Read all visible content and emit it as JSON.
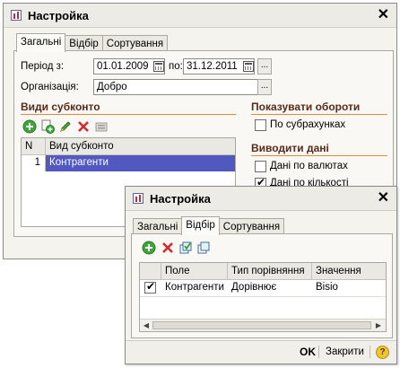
{
  "back_window": {
    "title": "Настройка",
    "close": "✕",
    "tabs": [
      "Загальні",
      "Відбір",
      "Сортування"
    ],
    "period_label": "Період з:",
    "period_from": "01.01.2009",
    "period_to_label": "по:",
    "period_to": "31.12.2011",
    "org_label": "Організація:",
    "org_value": "Добро",
    "ellipsis": "...",
    "subconto_title": "Види субконто",
    "grid_headers": [
      "N",
      "Вид субконто"
    ],
    "grid_rows": [
      {
        "n": "1",
        "kind": "Контрагенти"
      }
    ],
    "turnover_title": "Показувати обороти",
    "by_subaccounts": "По субрахунках",
    "output_title": "Виводити дані",
    "by_currency": "Дані по валютах",
    "by_quantity": "Дані по кількості",
    "checks": {
      "by_subaccounts": false,
      "by_currency": false,
      "by_quantity": true
    },
    "colors": {
      "selection": "#5158bf",
      "section_line": "#e08a3a"
    }
  },
  "front_window": {
    "title": "Настройка",
    "close": "✕",
    "tabs": [
      "Загальні",
      "Відбір",
      "Сортування"
    ],
    "grid_headers": [
      "Поле",
      "Тип порівняння",
      "Значення"
    ],
    "grid_rows": [
      {
        "checked": true,
        "field": "Контрагенти",
        "comparison": "Дорівнює",
        "value": "Bisio"
      }
    ],
    "ok": "OK",
    "close_label": "Закрити",
    "help": "?"
  }
}
